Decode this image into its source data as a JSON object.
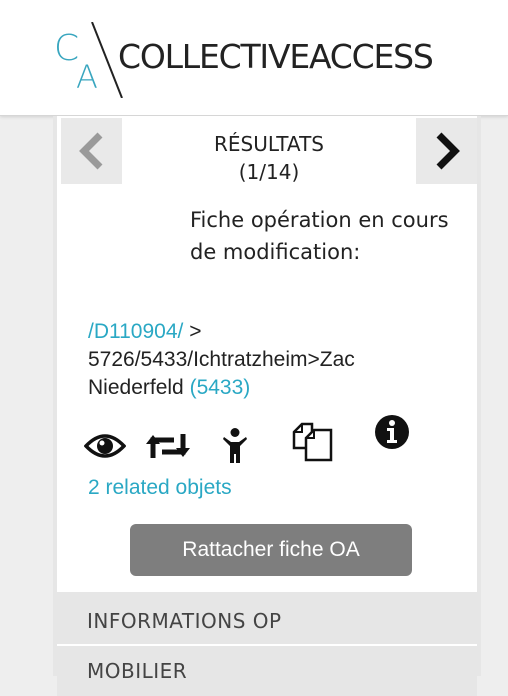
{
  "header": {
    "logo": {
      "letter_c": "C",
      "letter_a": "A",
      "wordmark": "COLLECTIVEACCESS"
    }
  },
  "navigation": {
    "prev_icon": "chevron-left-icon",
    "next_icon": "chevron-right-icon",
    "results_label": "RÉSULTATS",
    "results_count": "(1/14)"
  },
  "record": {
    "status_text": "Fiche opération en cours de modification:",
    "path_link": "/D110904/",
    "path_separator": " >",
    "path_text": "5726/5433/Ichtratzheim>Zac Niederfeld",
    "id_link": "(5433)"
  },
  "actions": {
    "icons": [
      "eye-icon",
      "retweet-icon",
      "child-icon",
      "copy-icon",
      "info-icon"
    ],
    "related_link": "2 related objets",
    "attach_button": "Rattacher fiche OA"
  },
  "sections": [
    {
      "label": "INFORMATIONS OP"
    },
    {
      "label": "MOBILIER"
    }
  ],
  "colors": {
    "accent": "#2aa8c4",
    "button": "#7e7e7e",
    "logo": "#39a6bf"
  }
}
